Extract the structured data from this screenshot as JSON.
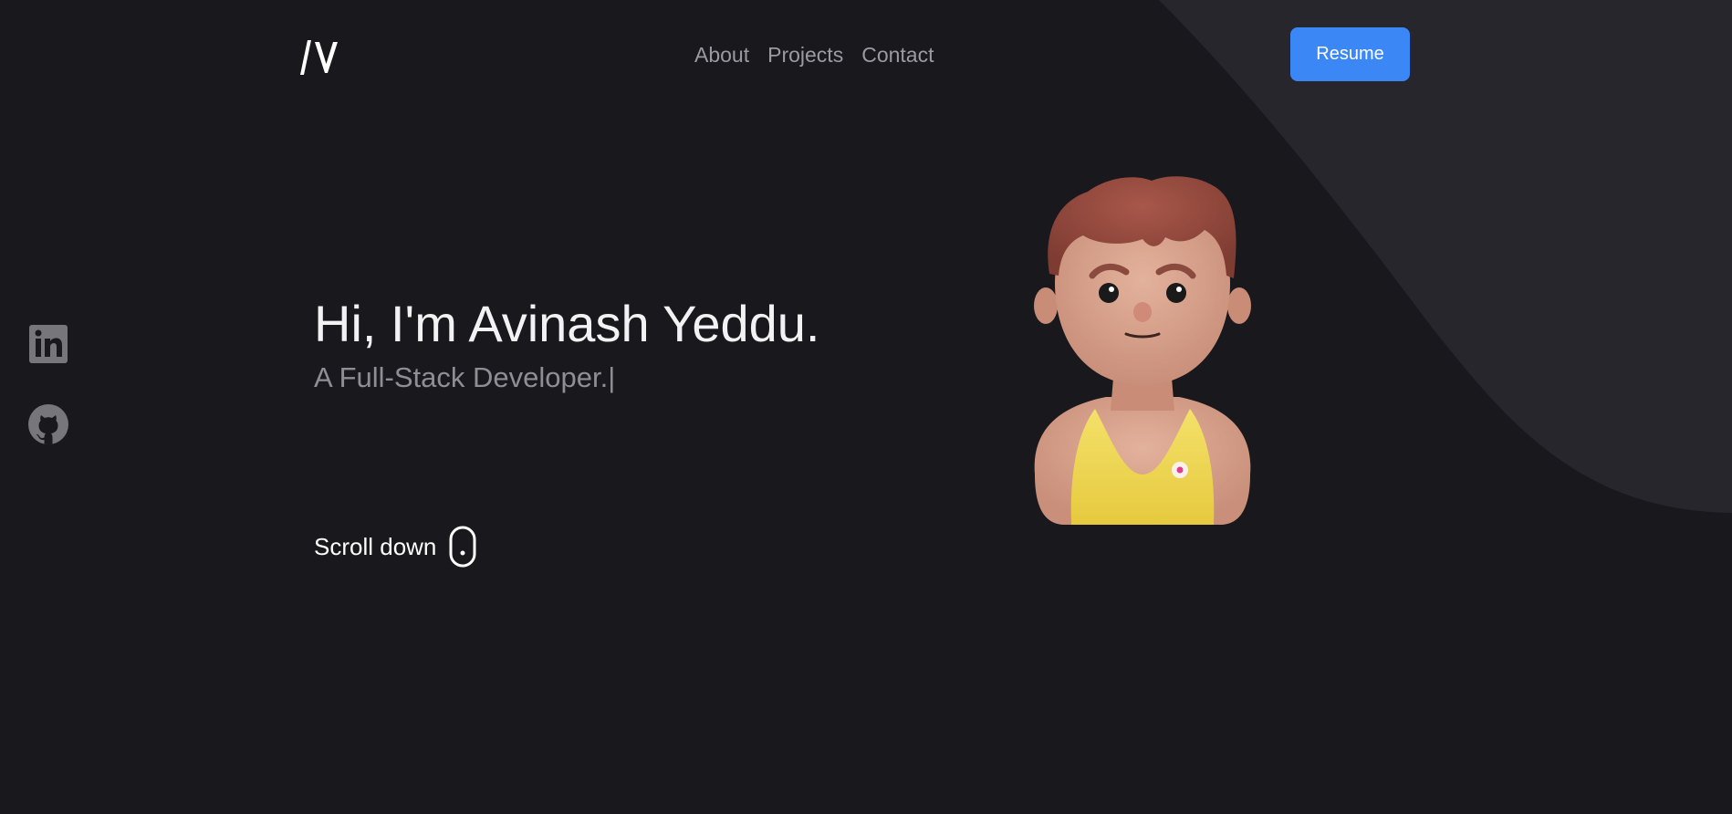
{
  "header": {
    "logo_alt": "AV",
    "nav": [
      {
        "label": "About"
      },
      {
        "label": "Projects"
      },
      {
        "label": "Contact"
      }
    ],
    "resume_label": "Resume"
  },
  "social": [
    {
      "icon": "linkedin-icon"
    },
    {
      "icon": "github-icon"
    }
  ],
  "hero": {
    "title": "Hi, I'm Avinash Yeddu.",
    "subtitle": "A Full-Stack Developer.",
    "cursor": "|"
  },
  "scroll": {
    "label": "Scroll down",
    "icon": "mouse-icon"
  },
  "colors": {
    "background": "#18181d",
    "wave": "#26262c",
    "accent": "#3b87f6",
    "nav_text": "#9a9aa0",
    "subtitle_text": "#8e8e94"
  }
}
